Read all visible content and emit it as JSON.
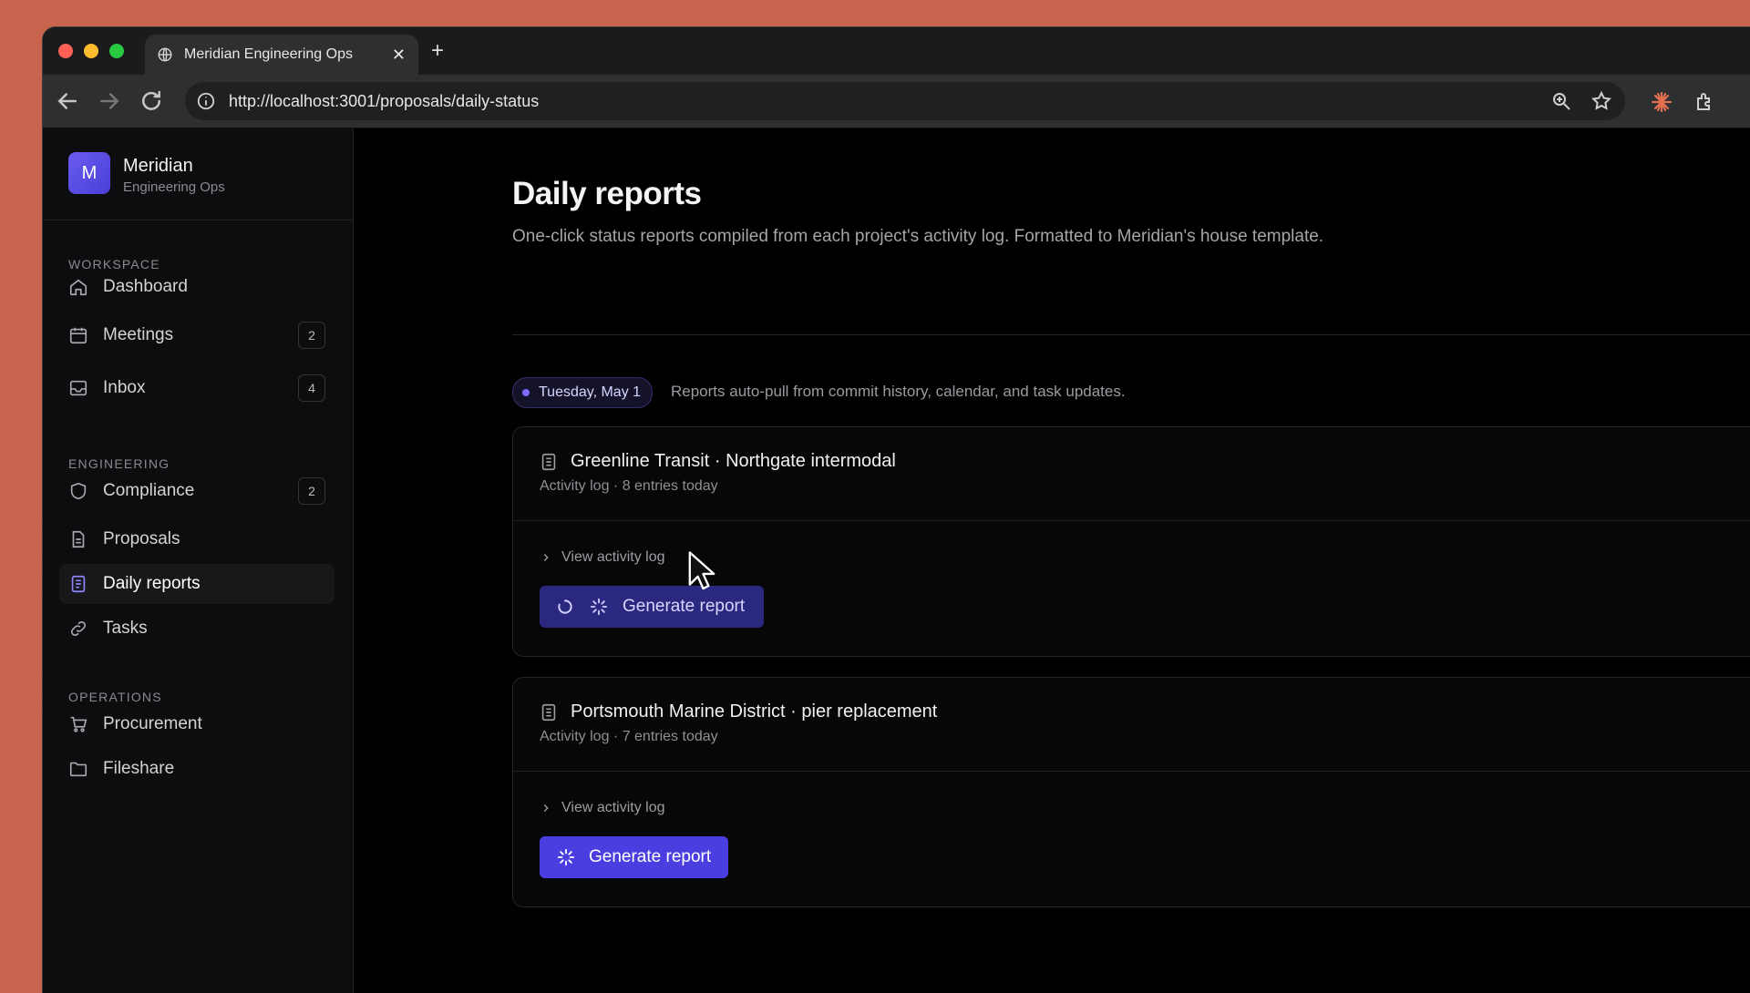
{
  "browser": {
    "tab_title": "Meridian Engineering Ops",
    "url": "http://localhost:3001/proposals/daily-status"
  },
  "brand": {
    "initial": "M",
    "name": "Meridian",
    "subtitle": "Engineering Ops"
  },
  "sidebar": {
    "sections": [
      {
        "label": "WORKSPACE"
      },
      {
        "label": "ENGINEERING"
      },
      {
        "label": "OPERATIONS"
      }
    ],
    "items": [
      {
        "label": "Dashboard",
        "icon": "home-icon"
      },
      {
        "label": "Meetings",
        "icon": "calendar-icon",
        "badge": "2"
      },
      {
        "label": "Inbox",
        "icon": "inbox-icon",
        "badge": "4"
      },
      {
        "label": "Compliance",
        "icon": "shield-icon",
        "badge": "2"
      },
      {
        "label": "Proposals",
        "icon": "document-icon"
      },
      {
        "label": "Daily reports",
        "icon": "report-icon",
        "active": true
      },
      {
        "label": "Tasks",
        "icon": "link-icon"
      },
      {
        "label": "Procurement",
        "icon": "cart-icon"
      },
      {
        "label": "Fileshare",
        "icon": "folder-icon"
      }
    ]
  },
  "main": {
    "title": "Daily reports",
    "description": "One-click status reports compiled from each project's activity log. Formatted to Meridian's house template.",
    "date_pill": "Tuesday, May 1",
    "date_note": "Reports auto-pull from commit history, calendar, and task updates.",
    "cards": [
      {
        "title": "Greenline Transit · Northgate intermodal",
        "meta": "Activity log · 8 entries today",
        "toggle": "View activity log",
        "button": "Generate report",
        "state": "loading"
      },
      {
        "title": "Portsmouth Marine District · pier replacement",
        "meta": "Activity log · 7 entries today",
        "toggle": "View activity log",
        "button": "Generate report",
        "state": "ready"
      }
    ]
  },
  "colors": {
    "accent": "#4a3ee0",
    "accent_loading": "#2b2880",
    "background": "#000000",
    "sidebar_bg": "#0d0d0f"
  }
}
